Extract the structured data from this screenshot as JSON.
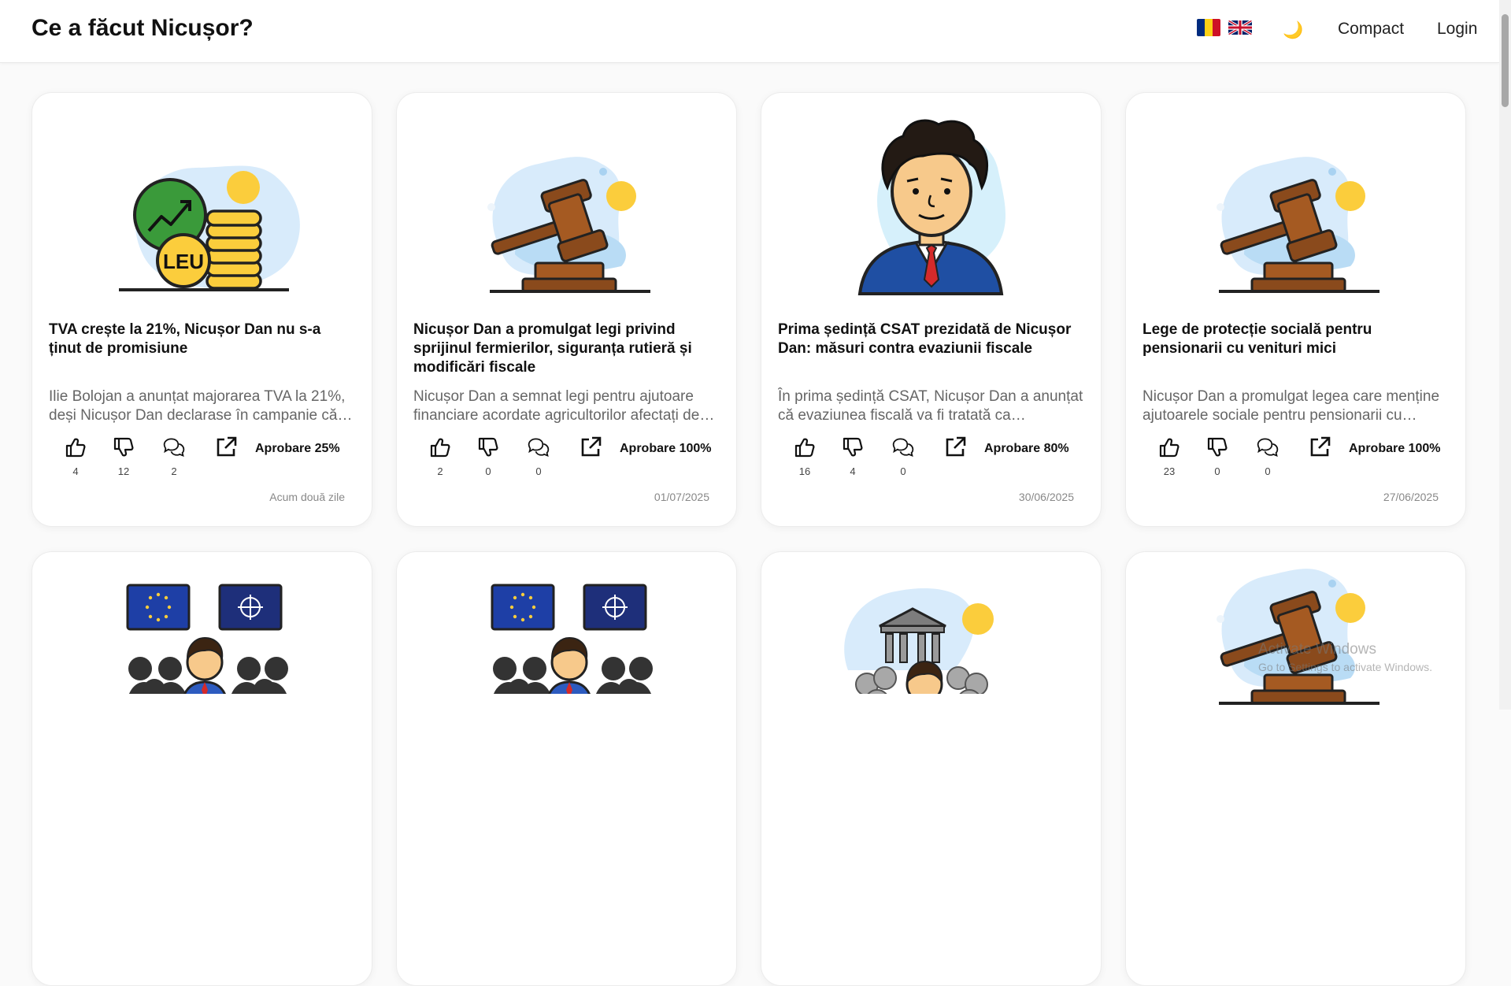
{
  "header": {
    "brand": "Ce a făcut Nicușor?",
    "nav": {
      "compact": "Compact",
      "login": "Login"
    },
    "icons": {
      "flag_ro": "romania-flag-icon",
      "flag_uk": "uk-flag-icon",
      "theme": "moon-icon"
    }
  },
  "cards": [
    {
      "title": "TVA crește la 21%, Nicușor Dan nu s-a ținut de promisiune",
      "description": "Ilie Bolojan a anunțat majorarea TVA la 21%, deși Nicușor Dan declarase în campanie că nu va crește TVA.",
      "likes": "4",
      "dislikes": "12",
      "comments": "2",
      "approval": "Aprobare 25%",
      "date": "Acum două zile",
      "illustration": "coins-growth-icon"
    },
    {
      "title": "Nicușor Dan a promulgat legi privind sprijinul fermierilor, siguranța rutieră și modificări fiscale",
      "description": "Nicușor Dan a semnat legi pentru ajutoare financiare acordate agricultorilor afectați de secetă.",
      "likes": "2",
      "dislikes": "0",
      "comments": "0",
      "approval": "Aprobare 100%",
      "date": "01/07/2025",
      "illustration": "gavel-icon"
    },
    {
      "title": "Prima ședință CSAT prezidată de Nicușor Dan: măsuri contra evaziunii fiscale",
      "description": "În prima ședință CSAT, Nicușor Dan a anunțat că evaziunea fiscală va fi tratată ca amenințare la securitatea națională.",
      "likes": "16",
      "dislikes": "4",
      "comments": "0",
      "approval": "Aprobare 80%",
      "date": "30/06/2025",
      "illustration": "president-portrait-icon"
    },
    {
      "title": "Lege de protecție socială pentru pensionarii cu venituri mici",
      "description": "Nicușor Dan a promulgat legea care menține ajutoarele sociale pentru pensionarii cu venituri mici.",
      "likes": "23",
      "dislikes": "0",
      "comments": "0",
      "approval": "Aprobare 100%",
      "date": "27/06/2025",
      "illustration": "gavel-icon"
    },
    {
      "illustration": "eu-nato-summit-icon"
    },
    {
      "illustration": "eu-nato-summit-icon"
    },
    {
      "illustration": "institution-crowd-icon"
    },
    {
      "illustration": "gavel-icon"
    }
  ],
  "watermark": {
    "line1": "Activate Windows",
    "line2": "Go to Settings to activate Windows."
  }
}
